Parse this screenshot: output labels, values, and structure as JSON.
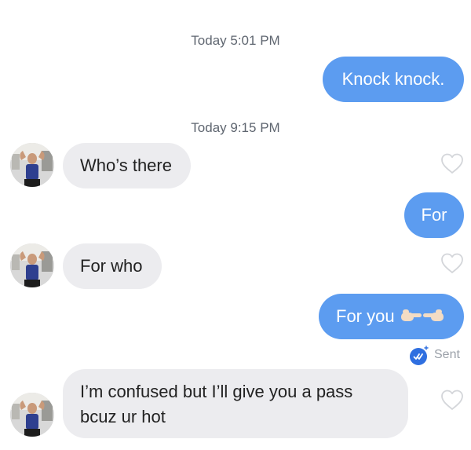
{
  "conversation": {
    "timestamps": [
      "Today 5:01 PM",
      "Today 9:15 PM"
    ],
    "messages": [
      {
        "direction": "outgoing",
        "text": "Knock knock."
      },
      {
        "direction": "incoming",
        "text": "Who’s there"
      },
      {
        "direction": "outgoing",
        "text": "For"
      },
      {
        "direction": "incoming",
        "text": "For who"
      },
      {
        "direction": "outgoing",
        "text": "For you"
      },
      {
        "direction": "incoming",
        "text": "I’m confused but I’ll give you a pass bcuz ur hot"
      }
    ],
    "status": {
      "label": "Sent"
    },
    "icons": {
      "like": "heart-outline-icon",
      "sent": "double-check-icon",
      "emoji": "pointing-hands-emoji"
    }
  },
  "colors": {
    "outgoing_bubble": "#5c9cf0",
    "incoming_bubble": "#ececef",
    "timestamp": "#5f6670",
    "sent_icon": "#2f6fe0"
  }
}
